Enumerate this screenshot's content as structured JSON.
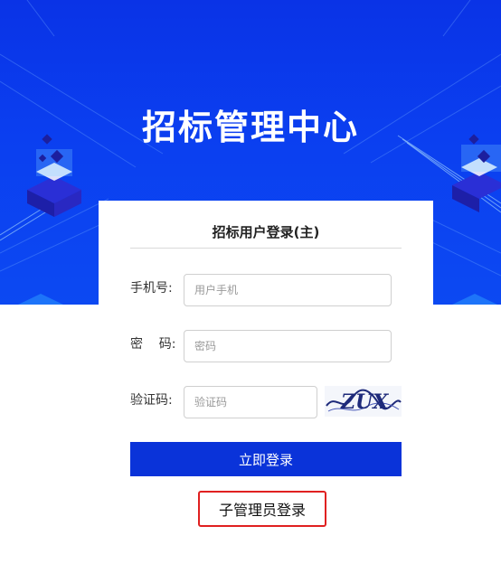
{
  "header": {
    "title": "招标管理中心"
  },
  "login": {
    "title": "招标用户登录(主)",
    "phone_label": "手机号:",
    "phone_placeholder": "用户手机",
    "password_label": "密    码:",
    "password_placeholder": "密码",
    "captcha_label": "验证码:",
    "captcha_placeholder": "验证码",
    "captcha_text": "ZUX",
    "submit_label": "立即登录",
    "sub_admin_label": "子管理员登录"
  },
  "colors": {
    "primary": "#0a33d9",
    "hero": "#0b3ff0",
    "highlight": "#e02020"
  }
}
